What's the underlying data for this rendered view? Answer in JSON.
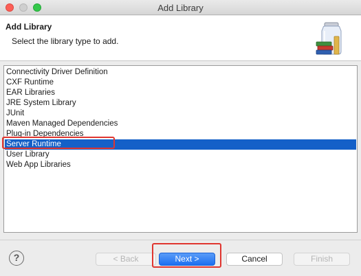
{
  "window": {
    "title": "Add Library"
  },
  "header": {
    "title": "Add Library",
    "description": "Select the library type to add."
  },
  "library_types": [
    {
      "label": "Connectivity Driver Definition",
      "selected": false
    },
    {
      "label": "CXF Runtime",
      "selected": false
    },
    {
      "label": "EAR Libraries",
      "selected": false
    },
    {
      "label": "JRE System Library",
      "selected": false
    },
    {
      "label": "JUnit",
      "selected": false
    },
    {
      "label": "Maven Managed Dependencies",
      "selected": false
    },
    {
      "label": "Plug-in Dependencies",
      "selected": false
    },
    {
      "label": "Server Runtime",
      "selected": true
    },
    {
      "label": "User Library",
      "selected": false
    },
    {
      "label": "Web App Libraries",
      "selected": false
    }
  ],
  "footer": {
    "help_label": "?",
    "back_label": "< Back",
    "next_label": "Next >",
    "cancel_label": "Cancel",
    "finish_label": "Finish"
  },
  "colors": {
    "selection": "#1460c8",
    "highlight": "#e0352f",
    "primary_button": "#1c6ff1"
  }
}
